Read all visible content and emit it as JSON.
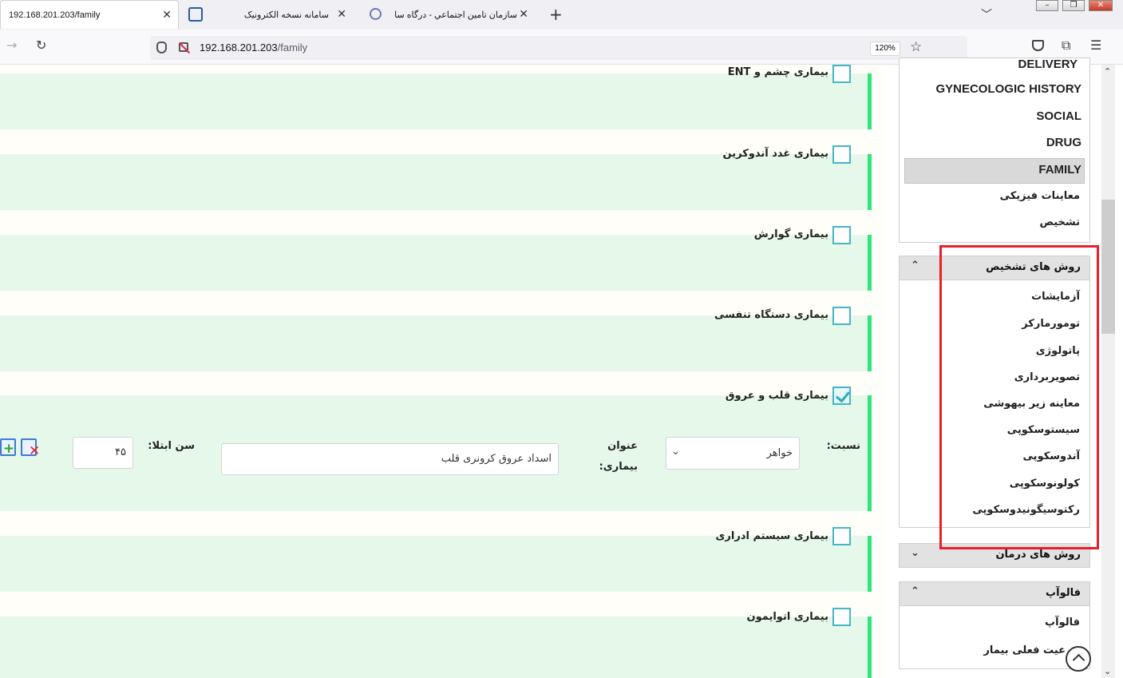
{
  "browser": {
    "tabs": [
      {
        "title": "192.168.201.203/family",
        "active": true
      },
      {
        "title": "سامانه نسخه الکترونیک",
        "active": false
      },
      {
        "title": "سازمان تامين اجتماعي - درگاه سا",
        "active": false
      }
    ],
    "new_tab_label": "+",
    "url_host": "192.168.201.203",
    "url_path": "/family",
    "zoom": "120%"
  },
  "diseases": [
    {
      "label": "بیماری چشم و ENT",
      "checked": false
    },
    {
      "label": "بیماری غدد آندوکرین",
      "checked": false
    },
    {
      "label": "بیماری گوارش",
      "checked": false
    },
    {
      "label": "بیماری دستگاه تنفسی",
      "checked": false
    },
    {
      "label": "بیماری قلب و عروق",
      "checked": true
    },
    {
      "label": "بیماری سیستم ادراری",
      "checked": false
    },
    {
      "label": "بیماری اتوایمون",
      "checked": false
    }
  ],
  "detail_form": {
    "relation_label": "نسبت:",
    "relation_value": "خواهر",
    "disease_title_label_1": "عنوان",
    "disease_title_label_2": "بیماری:",
    "disease_title_value": "اسداد عروق کرونری قلب",
    "age_label": "سن ابتلا:",
    "age_value": "۴۵"
  },
  "sidebar": {
    "history_items": [
      "DELIVERY",
      "GYNECOLOGIC HISTORY",
      "SOCIAL",
      "DRUG",
      "FAMILY"
    ],
    "exam_items": [
      "معاینات فیزیکی",
      "تشخیص"
    ],
    "active_item": "FAMILY",
    "diagnosis_header": "روش های تشخیص",
    "diagnosis_items": [
      "آزمایشات",
      "تومورمارکر",
      "پاتولوژی",
      "تصویربرداری",
      "معاینه زیر بیهوشی",
      "سیستوسکوپی",
      "آندوسکوپی",
      "کولونوسکوپی",
      "رکتوسیگونیدوسکوپی"
    ],
    "treatment_header": "روش های درمان",
    "followup_header": "فالوآپ",
    "followup_items": [
      "فالوآپ",
      "عیت فعلی بیمار"
    ]
  }
}
